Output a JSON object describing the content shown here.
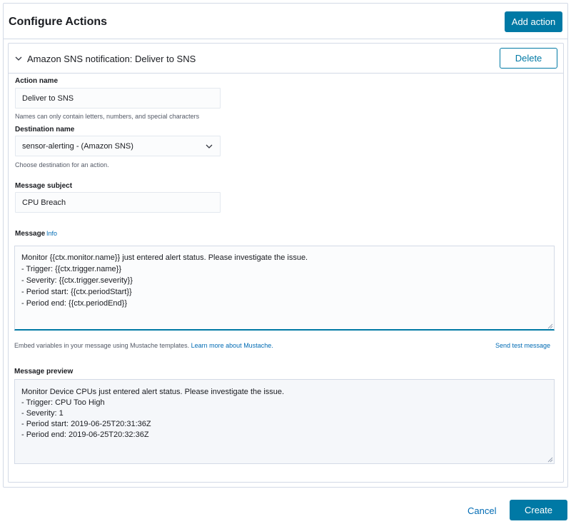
{
  "header": {
    "title": "Configure Actions",
    "add_action_label": "Add action"
  },
  "action": {
    "title": "Amazon SNS notification: Deliver to SNS",
    "delete_label": "Delete",
    "action_name": {
      "label": "Action name",
      "value": "Deliver to SNS",
      "help": "Names can only contain letters, numbers, and special characters"
    },
    "destination": {
      "label": "Destination name",
      "value": "sensor-alerting - (Amazon SNS)",
      "help": "Choose destination for an action."
    },
    "subject": {
      "label": "Message subject",
      "value": "CPU Breach"
    },
    "message": {
      "label": "Message",
      "info_label": "Info",
      "value": "Monitor {{ctx.monitor.name}} just entered alert status. Please investigate the issue.\n- Trigger: {{ctx.trigger.name}}\n- Severity: {{ctx.trigger.severity}}\n- Period start: {{ctx.periodStart}}\n- Period end: {{ctx.periodEnd}}",
      "help": "Embed variables in your message using Mustache templates.",
      "help_link": "Learn more about Mustache.",
      "send_test_label": "Send test message"
    },
    "preview": {
      "label": "Message preview",
      "value": "Monitor Device CPUs just entered alert status. Please investigate the issue.\n- Trigger: CPU Too High\n- Severity: 1\n- Period start: 2019-06-25T20:31:36Z\n- Period end: 2019-06-25T20:32:36Z"
    }
  },
  "footer": {
    "cancel_label": "Cancel",
    "create_label": "Create"
  },
  "icons": {
    "chevron": "chevron-down-icon",
    "caret": "caret-down-icon",
    "resize": "resize-handle-icon"
  },
  "colors": {
    "primary": "#0079a5",
    "link": "#006bb4",
    "border": "#d3dae6"
  }
}
